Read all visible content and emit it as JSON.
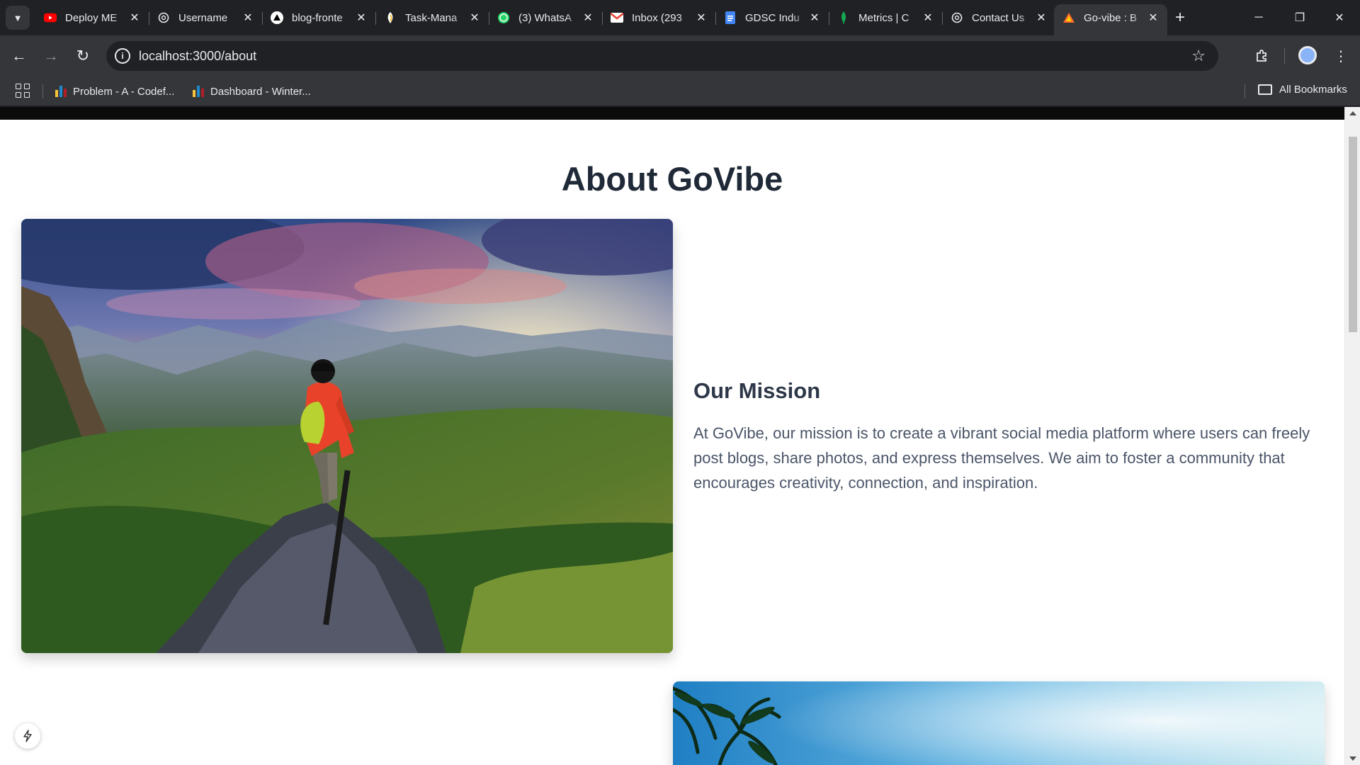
{
  "browser": {
    "tabs": [
      {
        "title": "Deploy ME",
        "icon": "youtube-icon"
      },
      {
        "title": "Username",
        "icon": "openai-icon"
      },
      {
        "title": "blog-fronte",
        "icon": "vercel-icon"
      },
      {
        "title": "Task-Mana",
        "icon": "taskmanager-icon"
      },
      {
        "title": "(3) WhatsA",
        "icon": "whatsapp-icon"
      },
      {
        "title": "Inbox (293",
        "icon": "gmail-icon"
      },
      {
        "title": "GDSC Indu",
        "icon": "google-docs-icon"
      },
      {
        "title": "Metrics | C",
        "icon": "mongodb-icon"
      },
      {
        "title": "Contact Us",
        "icon": "openai-icon"
      },
      {
        "title": "Go-vibe : B",
        "icon": "govibe-icon",
        "active": true
      }
    ],
    "address": "localhost:3000/about",
    "bookmarks": [
      {
        "label": "Problem - A - Codef..."
      },
      {
        "label": "Dashboard - Winter..."
      }
    ],
    "all_bookmarks_label": "All Bookmarks"
  },
  "page": {
    "title": "About GoVibe",
    "mission": {
      "heading": "Our Mission",
      "body": "At GoVibe, our mission is to create a vibrant social media platform where users can freely post blogs, share photos, and express themselves. We aim to foster a community that encourages creativity, connection, and inspiration."
    }
  },
  "colors": {
    "heading": "#1f2937",
    "body_text": "#4a5568",
    "browser_dark": "#202124",
    "browser_toolbar": "#35363a"
  }
}
